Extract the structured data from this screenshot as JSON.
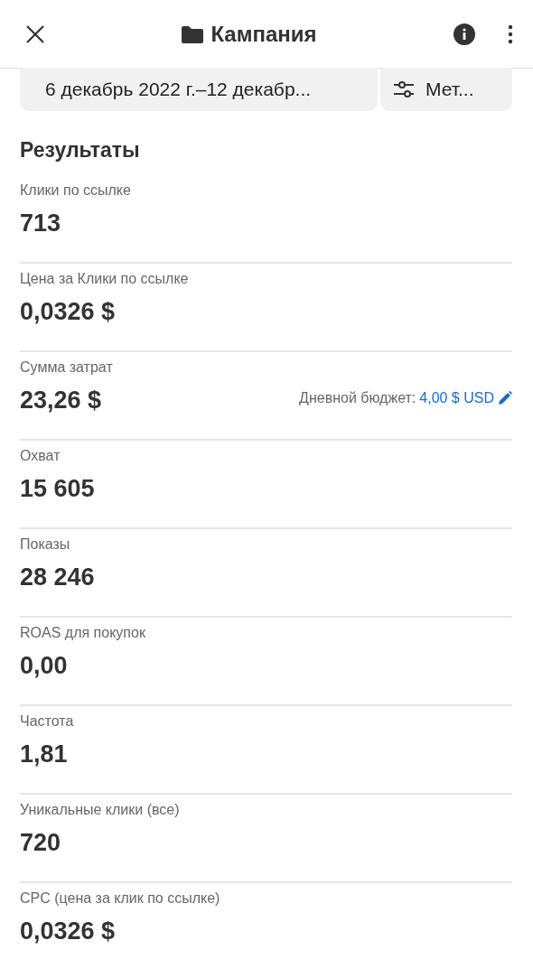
{
  "header": {
    "title": "Кампания"
  },
  "filters": {
    "date_range": "6 декабрь 2022 г.–12 декабр...",
    "metrics": "Мет..."
  },
  "section_title": "Результаты",
  "metrics": [
    {
      "label": "Клики по ссылке",
      "value": "713"
    },
    {
      "label": "Цена за Клики по ссылке",
      "value": "0,0326 $"
    },
    {
      "label": "Сумма затрат",
      "value": "23,26 $",
      "budget": {
        "label": "Дневной бюджет:",
        "value": "4,00 $ USD"
      }
    },
    {
      "label": "Охват",
      "value": "15 605"
    },
    {
      "label": "Показы",
      "value": "28 246"
    },
    {
      "label": "ROAS для покупок",
      "value": "0,00"
    },
    {
      "label": "Частота",
      "value": "1,81"
    },
    {
      "label": "Уникальные клики (все)",
      "value": "720"
    },
    {
      "label": "CPC (цена за клик по ссылке)",
      "value": "0,0326 $"
    }
  ]
}
